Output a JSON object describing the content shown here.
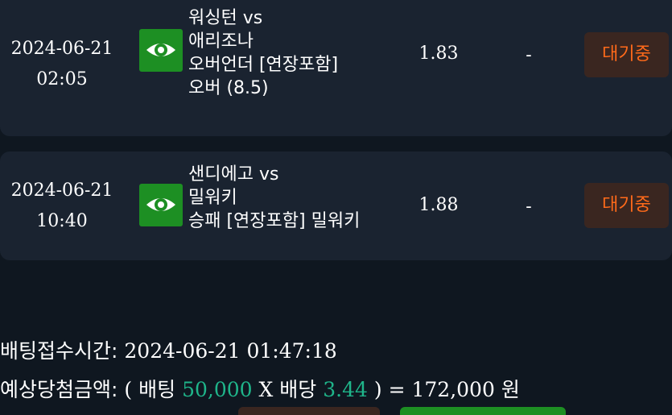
{
  "bets": [
    {
      "date": "2024-06-21",
      "time": "02:05",
      "team1_line": "워싱턴 vs",
      "team2_line": "애리조나",
      "market": "오버언더 [연장포함]",
      "pick": "오버 (8.5)",
      "odds": "1.83",
      "result": "-",
      "status": "대기중"
    },
    {
      "date": "2024-06-21",
      "time": "10:40",
      "team1_line": "샌디에고 vs",
      "team2_line": "밀워키",
      "market": "승패 [연장포함] 밀워키",
      "odds": "1.88",
      "result": "-",
      "status": "대기중"
    }
  ],
  "summary": {
    "accept_label": "배팅접수시간:",
    "accept_time": "2024-06-21 01:47:18",
    "expected_label": "예상당첨금액:",
    "open_paren": "(",
    "bet_label": "배팅",
    "bet_amount": "50,000",
    "multiply": "X",
    "odds_label": "배당",
    "total_odds": "3.44",
    "close_eq": ") =",
    "payout": "172,000",
    "currency": "원"
  },
  "colors": {
    "background": "#0f1720",
    "card": "#1a2330",
    "eye_button": "#1d8f23",
    "status_text": "#ff6a1a",
    "status_button": "#3a2620",
    "highlight_green": "#1fb58a"
  },
  "icons": {
    "view_button": "eye-icon"
  }
}
